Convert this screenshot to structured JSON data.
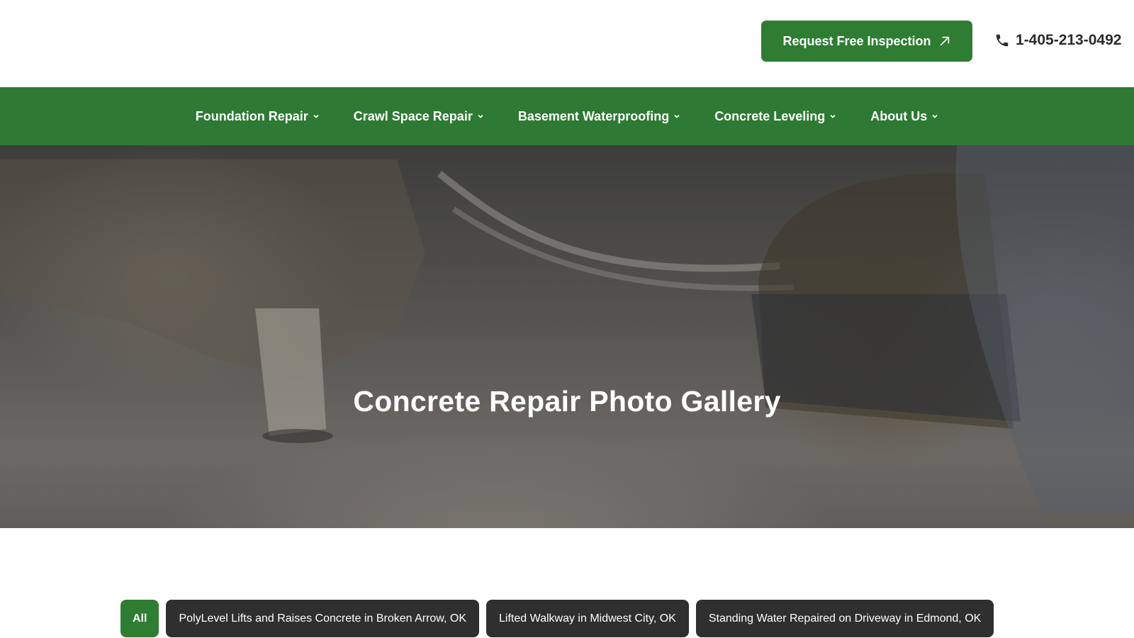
{
  "header": {
    "cta_label": "Request Free Inspection",
    "cta_icon": "arrow-up-right-icon",
    "phone": "1-405-213-0492",
    "phone_icon": "phone-icon"
  },
  "nav": {
    "items": [
      {
        "label": "Foundation Repair"
      },
      {
        "label": "Crawl Space Repair"
      },
      {
        "label": "Basement Waterproofing"
      },
      {
        "label": "Concrete Leveling"
      },
      {
        "label": "About Us"
      }
    ],
    "dropdown_icon": "chevron-down-icon"
  },
  "hero": {
    "title": "Concrete Repair Photo Gallery"
  },
  "filters": {
    "items": [
      {
        "label": "All",
        "active": true
      },
      {
        "label": "PolyLevel Lifts and Raises Concrete in Broken Arrow, OK",
        "active": false
      },
      {
        "label": "Lifted Walkway in Midwest City, OK",
        "active": false
      },
      {
        "label": "Standing Water Repaired on Driveway in Edmond, OK",
        "active": false
      }
    ]
  },
  "colors": {
    "brand_green": "#2e7d32",
    "nav_green": "#2e7a34",
    "filter_dark": "#2f2f2f"
  }
}
